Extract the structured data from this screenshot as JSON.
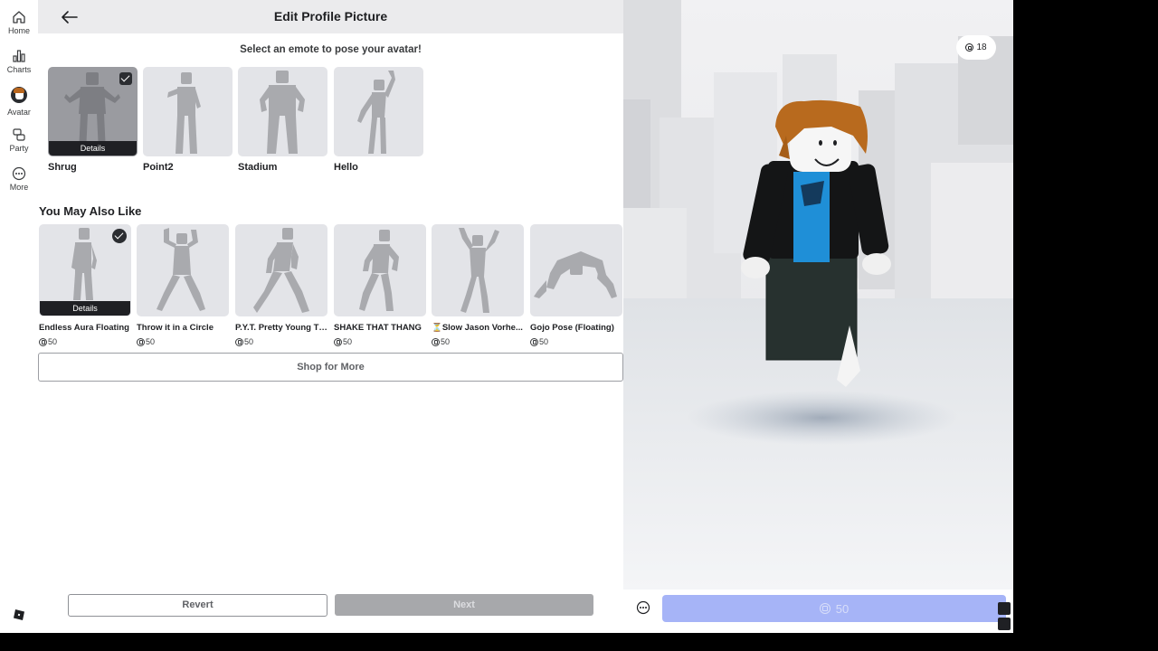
{
  "header": {
    "title": "Edit Profile Picture"
  },
  "nav": {
    "items": [
      {
        "label": "Home",
        "icon": "home-icon"
      },
      {
        "label": "Charts",
        "icon": "charts-icon"
      },
      {
        "label": "Avatar",
        "icon": "avatar-icon"
      },
      {
        "label": "Party",
        "icon": "party-icon"
      },
      {
        "label": "More",
        "icon": "more-icon"
      }
    ]
  },
  "prompt": "Select an emote to pose your avatar!",
  "emotes": [
    {
      "name": "Shrug",
      "selected": true,
      "details_label": "Details"
    },
    {
      "name": "Point2",
      "selected": false
    },
    {
      "name": "Stadium",
      "selected": false
    },
    {
      "name": "Hello",
      "selected": false
    }
  ],
  "recommendations": {
    "title": "You May Also Like",
    "items": [
      {
        "name": "Endless Aura Floating",
        "price": "50",
        "selected": true,
        "details_label": "Details"
      },
      {
        "name": "Throw it in a Circle",
        "price": "50"
      },
      {
        "name": "P.Y.T. Pretty Young Th...",
        "price": "50"
      },
      {
        "name": "SHAKE THAT THANG",
        "price": "50"
      },
      {
        "name": "⏳Slow Jason Vorhe...",
        "price": "50"
      },
      {
        "name": "Gojo Pose (Floating)",
        "price": "50"
      }
    ]
  },
  "buttons": {
    "shop_more": "Shop for More",
    "revert": "Revert",
    "next": "Next"
  },
  "balance": "18",
  "purchase": {
    "price": "50"
  },
  "colors": {
    "accent": "#a6b4f7",
    "selected_tile": "#9a9ba0",
    "tile": "#e3e4e8"
  }
}
